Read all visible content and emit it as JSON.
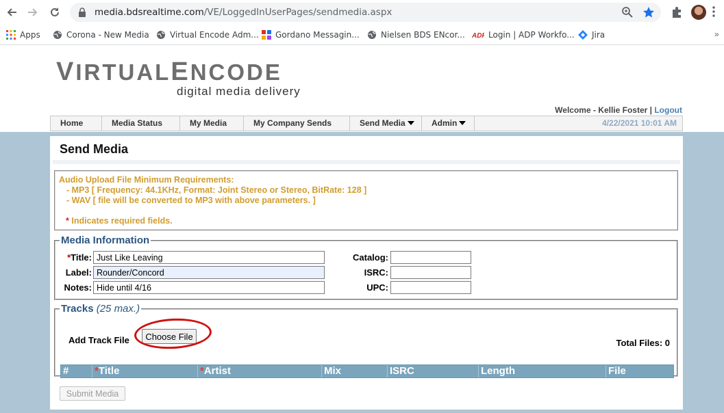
{
  "browser": {
    "url_host": "media.bdsrealtime.com",
    "url_path": "/VE/LoggedInUserPages/sendmedia.aspx",
    "bookmarks": [
      {
        "label": "Apps",
        "icon": "apps-grid-icon"
      },
      {
        "label": "Corona - New Media",
        "icon": "globe-icon"
      },
      {
        "label": "Virtual Encode Adm...",
        "icon": "globe-icon"
      },
      {
        "label": "Gordano Messagin...",
        "icon": "gordano-icon"
      },
      {
        "label": "Nielsen BDS ENcor...",
        "icon": "globe-icon"
      },
      {
        "label": "Login | ADP Workfo...",
        "icon": "adp-icon"
      },
      {
        "label": "Jira",
        "icon": "jira-icon"
      }
    ],
    "more_label": "»"
  },
  "logo": {
    "first": "V",
    "rest1": "IRTUAL",
    "second": "E",
    "rest2": "NCODE",
    "tagline": "digital media delivery"
  },
  "header": {
    "welcome": "Welcome - Kellie Foster |",
    "logout": "Logout",
    "date": "4/22/2021 10:01 AM"
  },
  "menu": [
    "Home",
    "Media Status",
    "My Media",
    "My Company Sends",
    "Send Media",
    "Admin"
  ],
  "page": {
    "title": "Send Media",
    "requirements": {
      "heading": "Audio Upload File Minimum Requirements:",
      "mp3": "- MP3  [ Frequency: 44.1KHz, Format: Joint Stereo or Stereo, BitRate: 128 ]",
      "wav": "- WAV [ file will be converted to MP3 with above parameters. ]",
      "star": "*",
      "required_note": "Indicates required fields."
    },
    "media_info": {
      "legend": "Media Information",
      "star": "*",
      "title_label": "Title:",
      "title_value": "Just Like Leaving",
      "label_label": "Label:",
      "label_value": "Rounder/Concord",
      "notes_label": "Notes:",
      "notes_value": "Hide until 4/16",
      "catalog_label": "Catalog:",
      "catalog_value": "",
      "isrc_label": "ISRC:",
      "isrc_value": "",
      "upc_label": "UPC:",
      "upc_value": ""
    },
    "tracks": {
      "legend": "Tracks",
      "legend_note": "(25 max.)",
      "add_label": "Add Track File",
      "choose_button": "Choose File",
      "total_label": "Total Files: 0",
      "columns": [
        "#",
        "Title",
        "Artist",
        "Mix",
        "ISRC",
        "Length",
        "File"
      ],
      "star": "*"
    },
    "submit_label": "Submit Media"
  },
  "colors": {
    "accent_blue": "#2c5680",
    "requirements_text": "#d19d2f",
    "body_background": "#adc5d4",
    "table_header": "#7aa5bc",
    "highlight_circle": "#d01010"
  }
}
